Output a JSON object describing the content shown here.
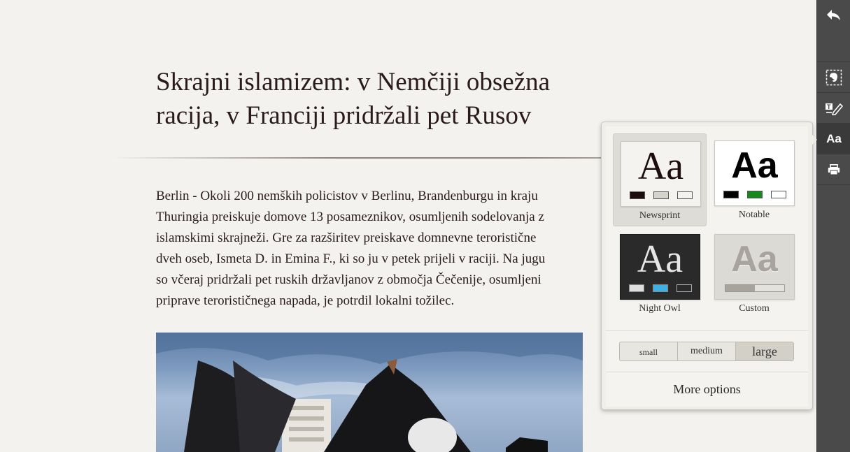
{
  "article": {
    "title_lines": [
      "Skrajni islamizem: v Nemčiji obsežna",
      "racija, v Franciji pridržali pet Rusov"
    ],
    "body_lines": [
      "Berlin -  Okoli 200 nemških policistov v Berlinu, Brandenburgu in kraju",
      "Thuringia preiskuje domove 13 posameznikov, osumljenih sodelovanja z",
      "islamskimi skrajneži. Gre za razširitev preiskave domnevne teroristične",
      "dveh oseb, Ismeta D. in Emina F., ki so ju v petek prijeli v raciji. Na jugu",
      "so včeraj pridržali pet ruskih državljanov z območja Čečenije, osumljeni",
      "priprave terorističnega napada, je potrdil lokalni tožilec."
    ]
  },
  "toolbar": {
    "items": [
      {
        "name": "back",
        "icon": "back-arrow-icon"
      },
      {
        "name": "clip",
        "icon": "evernote-clip-icon"
      },
      {
        "name": "highlight",
        "icon": "highlight-pen-icon"
      },
      {
        "name": "text-style",
        "label": "Aa",
        "active": true
      },
      {
        "name": "print",
        "icon": "printer-icon"
      }
    ]
  },
  "popup": {
    "themes": [
      {
        "label": "Newsprint",
        "sample": "Aa",
        "selected": true,
        "colors": [
          "#1d0d10",
          "#d6d2cc",
          "#f3f2ef"
        ]
      },
      {
        "label": "Notable",
        "sample": "Aa",
        "selected": false,
        "colors": [
          "#000000",
          "#15891b",
          "#ffffff"
        ]
      },
      {
        "label": "Night Owl",
        "sample": "Aa",
        "selected": false,
        "colors": [
          "#dedede",
          "#3fb0e6",
          "#2a2a2a"
        ]
      },
      {
        "label": "Custom",
        "sample": "Aa",
        "selected": false,
        "colors": [
          "#a8a39d",
          "#e4e2dc"
        ]
      }
    ],
    "sizes": {
      "small": "small",
      "medium": "medium",
      "large": "large",
      "selected": "large"
    },
    "more_options": "More options"
  }
}
